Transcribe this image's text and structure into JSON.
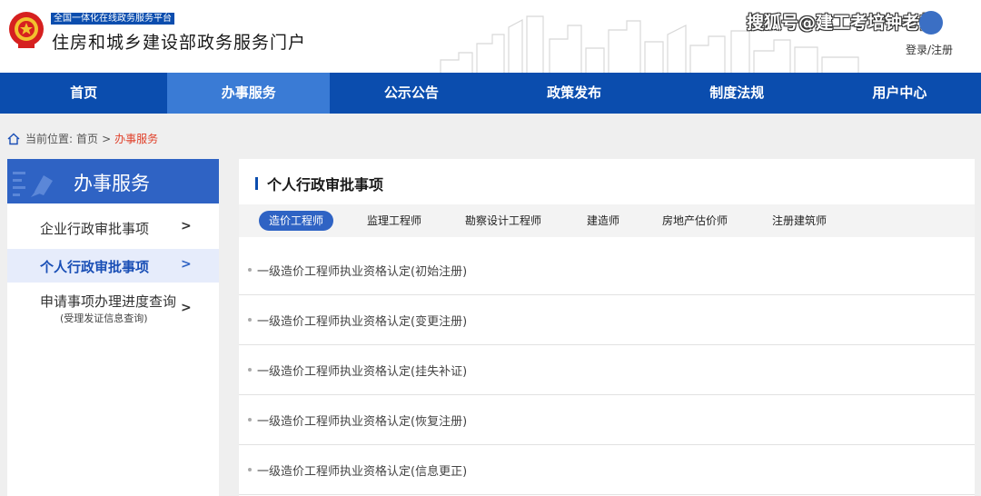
{
  "header": {
    "platform_tag": "全国一体化在线政务服务平台",
    "portal_title": "住房和城乡建设部政务服务门户",
    "watermark": "搜狐号@建工考培钟老师",
    "login_link": "登录/注册"
  },
  "nav": {
    "items": [
      {
        "label": "首页",
        "active": false
      },
      {
        "label": "办事服务",
        "active": true
      },
      {
        "label": "公示公告",
        "active": false
      },
      {
        "label": "政策发布",
        "active": false
      },
      {
        "label": "制度法规",
        "active": false
      },
      {
        "label": "用户中心",
        "active": false
      }
    ]
  },
  "breadcrumb": {
    "prefix": "当前位置:",
    "home": "首页",
    "separator": ">",
    "current": "办事服务"
  },
  "sidebar": {
    "title": "办事服务",
    "items": [
      {
        "label": "企业行政审批事项",
        "arrow": ">"
      },
      {
        "label": "个人行政审批事项",
        "arrow": ">"
      },
      {
        "label": "申请事项办理进度查询",
        "sub": "(受理发证信息查询)",
        "arrow": ">"
      }
    ]
  },
  "main": {
    "title": "个人行政审批事项",
    "tabs": [
      "造价工程师",
      "监理工程师",
      "勘察设计工程师",
      "建造师",
      "房地产估价师",
      "注册建筑师"
    ],
    "active_tab": "造价工程师",
    "list": [
      "一级造价工程师执业资格认定(初始注册)",
      "一级造价工程师执业资格认定(变更注册)",
      "一级造价工程师执业资格认定(挂失补证)",
      "一级造价工程师执业资格认定(恢复注册)",
      "一级造价工程师执业资格认定(信息更正)"
    ]
  },
  "colors": {
    "nav_bg": "#0b4dae",
    "nav_active": "#3a7bd5",
    "sidebar_head": "#2f63c4",
    "breadcrumb_current": "#e0402a"
  }
}
